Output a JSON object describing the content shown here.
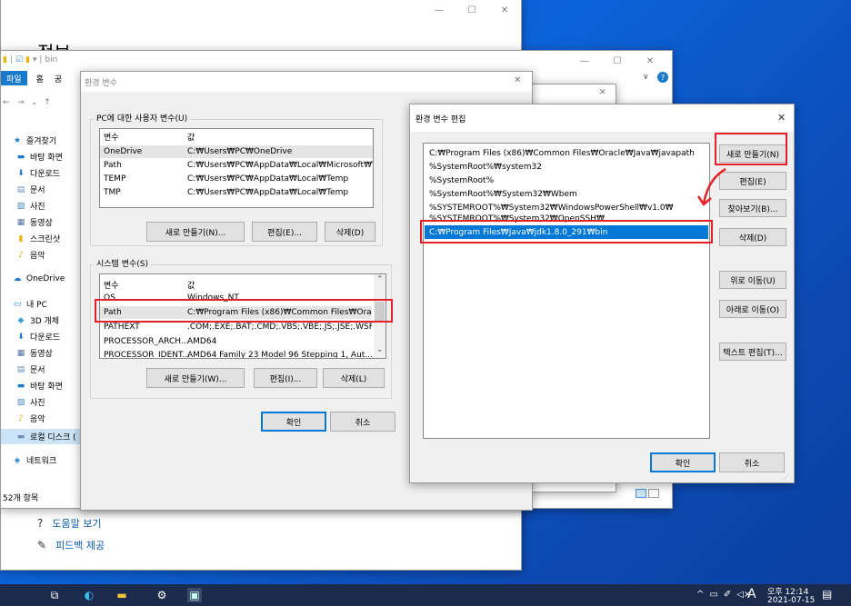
{
  "settings_window": {
    "title_partial": "정보",
    "help_link": "도움말 보기",
    "feedback_link": "피드백 제공"
  },
  "explorer": {
    "title": "bin",
    "ribbon_tabs": [
      "파일",
      "홈",
      "공"
    ],
    "status": "52개 항목",
    "nav": [
      {
        "label": "즐겨찾기",
        "icon": "star-icon"
      },
      {
        "label": "바탕 화면",
        "icon": "desktop-icon"
      },
      {
        "label": "다운로드",
        "icon": "download-icon"
      },
      {
        "label": "문서",
        "icon": "document-icon"
      },
      {
        "label": "사진",
        "icon": "picture-icon"
      },
      {
        "label": "동영상",
        "icon": "video-icon"
      },
      {
        "label": "스크린샷",
        "icon": "folder-icon"
      },
      {
        "label": "음악",
        "icon": "music-icon"
      },
      {
        "label": "OneDrive",
        "icon": "cloud-icon"
      },
      {
        "label": "내 PC",
        "icon": "pc-icon"
      },
      {
        "label": "3D 개체",
        "icon": "cube-icon"
      },
      {
        "label": "다운로드",
        "icon": "download-icon"
      },
      {
        "label": "동영상",
        "icon": "video-icon"
      },
      {
        "label": "문서",
        "icon": "document-icon"
      },
      {
        "label": "바탕 화면",
        "icon": "desktop-icon"
      },
      {
        "label": "사진",
        "icon": "picture-icon"
      },
      {
        "label": "음악",
        "icon": "music-icon"
      },
      {
        "label": "로컬 디스크 (",
        "icon": "disk-icon"
      },
      {
        "label": "네트워크",
        "icon": "network-icon"
      }
    ]
  },
  "env_dialog": {
    "title": "환경 변수",
    "user_group": "PC에 대한 사용자 변수(U)",
    "col_var": "변수",
    "col_val": "값",
    "user_vars": [
      {
        "name": "OneDrive",
        "value": "C:₩Users₩PC₩OneDrive"
      },
      {
        "name": "Path",
        "value": "C:₩Users₩PC₩AppData₩Local₩Microsoft₩W..."
      },
      {
        "name": "TEMP",
        "value": "C:₩Users₩PC₩AppData₩Local₩Temp"
      },
      {
        "name": "TMP",
        "value": "C:₩Users₩PC₩AppData₩Local₩Temp"
      }
    ],
    "user_new": "새로 만들기(N)...",
    "user_edit": "편집(E)...",
    "user_delete": "삭제(D)",
    "system_group": "시스템 변수(S)",
    "system_vars": [
      {
        "name": "OS",
        "value": "Windows_NT"
      },
      {
        "name": "Path",
        "value": "C:₩Program Files (x86)₩Common Files₩Orac..."
      },
      {
        "name": "PATHEXT",
        "value": ".COM;.EXE;.BAT;.CMD;.VBS;.VBE;.JS;.JSE;.WSF;..."
      },
      {
        "name": "PROCESSOR_ARCH...",
        "value": "AMD64"
      },
      {
        "name": "PROCESSOR_IDENT...",
        "value": "AMD64 Family 23 Model 96 Stepping 1, Aut..."
      }
    ],
    "sys_new": "새로 만들기(W)...",
    "sys_edit": "편집(I)...",
    "sys_delete": "삭제(L)",
    "ok": "확인",
    "cancel": "취소"
  },
  "edit_dialog": {
    "title": "환경 변수 편집",
    "paths": [
      "C:₩Program Files (x86)₩Common Files₩Oracle₩Java₩javapath",
      "%SystemRoot%₩system32",
      "%SystemRoot%",
      "%SystemRoot%₩System32₩Wbem",
      "%SYSTEMROOT%₩System32₩WindowsPowerShell₩v1.0₩",
      "%SYSTEMROOT%₩System32₩OpenSSH₩",
      "C:₩Program Files₩Java₩jdk1.8.0_291₩bin"
    ],
    "selected_index": 6,
    "new": "새로 만들기(N)",
    "edit": "편집(E)",
    "browse": "찾아보기(B)...",
    "delete": "삭제(D)",
    "up": "위로 이동(U)",
    "down": "아래로 이동(O)",
    "text_edit": "텍스트 편집(T)...",
    "ok": "확인",
    "cancel": "취소"
  },
  "taskbar": {
    "time": "오후 12:14",
    "date": "2021-07-15",
    "ime": "A"
  },
  "colors": {
    "accent": "#0078d7",
    "highlight": "#e6202a",
    "taskbar": "#1a2b4e"
  }
}
